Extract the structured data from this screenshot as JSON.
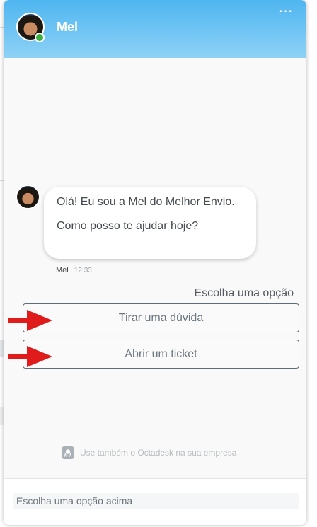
{
  "header": {
    "agent_name": "Mel",
    "menu_icon": "more-dots-icon",
    "status": "online",
    "gradient_colors": [
      "#4fb6f0",
      "#8fd2f6"
    ]
  },
  "conversation": {
    "messages": [
      {
        "sender": "Mel",
        "time": "12:33",
        "lines": [
          "Olá! Eu sou a Mel do Melhor Envio.",
          "Como posso te ajudar hoje?"
        ]
      }
    ],
    "options_label": "Escolha uma opção",
    "options": [
      {
        "label": "Tirar uma dúvida"
      },
      {
        "label": "Abrir um ticket"
      }
    ],
    "annotation_arrow_color": "#e01b1b"
  },
  "footer": {
    "powered_by": "Use também o Octadesk na sua empresa",
    "powered_icon": "octadesk-logo-icon",
    "input_placeholder": "Escolha uma opção acima"
  },
  "colors": {
    "online_status": "#3cb043",
    "option_border": "#5f6e78"
  }
}
